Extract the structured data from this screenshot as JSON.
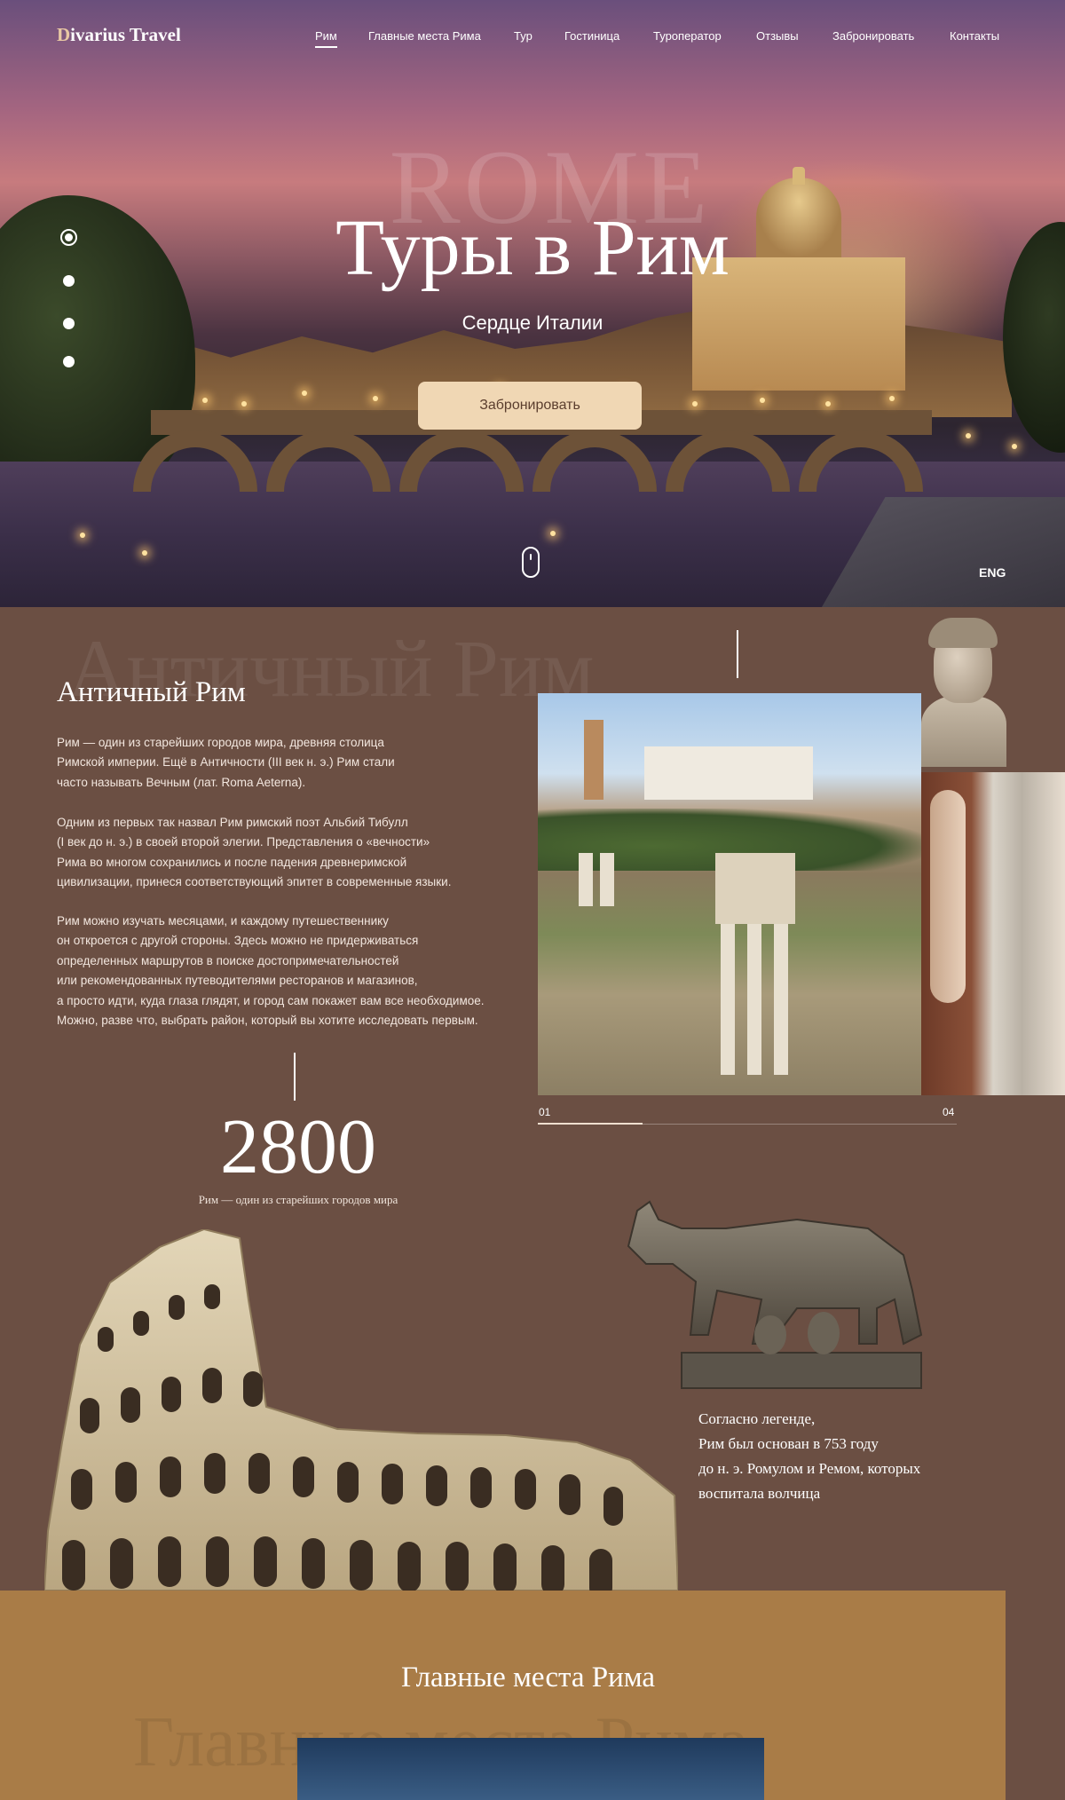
{
  "header": {
    "logo_first": "D",
    "logo_rest": "ivarius Travel",
    "nav": [
      {
        "label": "Рим",
        "active": true
      },
      {
        "label": "Главные места Рима"
      },
      {
        "label": "Тур"
      },
      {
        "label": "Гостиница"
      },
      {
        "label": "Туроператор"
      },
      {
        "label": "Отзывы"
      },
      {
        "label": "Забронировать"
      },
      {
        "label": "Контакты"
      }
    ]
  },
  "hero": {
    "ghost_word": "ROME",
    "title": "Туры в Рим",
    "subtitle": "Сердце Италии",
    "book_button": "Забронировать",
    "slide_dots": 4,
    "active_dot": 1,
    "lang": "ENG"
  },
  "ancient": {
    "ghost_heading": "Античный Рим",
    "title": "Античный Рим",
    "paragraphs": [
      [
        "Рим — один из старейших городов мира, древняя столица",
        "Римской империи.  Ещё в Античности (III век н. э.) Рим стали",
        "часто называть Вечным (лат. Roma Aeterna)."
      ],
      [
        "Одним из первых так назвал Рим римский поэт Альбий Тибулл",
        "(I век до н. э.) в своей второй элегии. Представления о «вечности»",
        "Рима во многом сохранились и после падения древнеримской",
        "цивилизации, принеся соответствующий эпитет в современные языки."
      ],
      [
        "Рим можно изучать месяцами, и каждому путешественнику",
        "он откроется с другой стороны. Здесь можно не придерживаться",
        "определенных маршрутов в поиске достопримечательностей",
        "или рекомендованных путеводителями ресторанов и магазинов,",
        "а просто идти, куда глаза глядят, и город сам покажет вам все необходимое.",
        "Можно, разве что, выбрать район, который вы хотите исследовать первым."
      ]
    ],
    "slider": {
      "current": "01",
      "total": "04",
      "progress": 0.25
    },
    "stat_number": "2800",
    "stat_caption": "Рим — один из старейших городов мира",
    "legend": [
      "Согласно легенде,",
      "Рим был основан в 753 году",
      "до н. э. Ромулом и Ремом, которых",
      "воспитала волчица"
    ]
  },
  "places": {
    "title": "Главные места Рима",
    "ghost_heading": "Главные места Рима"
  },
  "colors": {
    "background": "#6b4f43",
    "band": "#a97c47",
    "button": "#f0d7b4",
    "button_text": "#5b3e2e"
  }
}
